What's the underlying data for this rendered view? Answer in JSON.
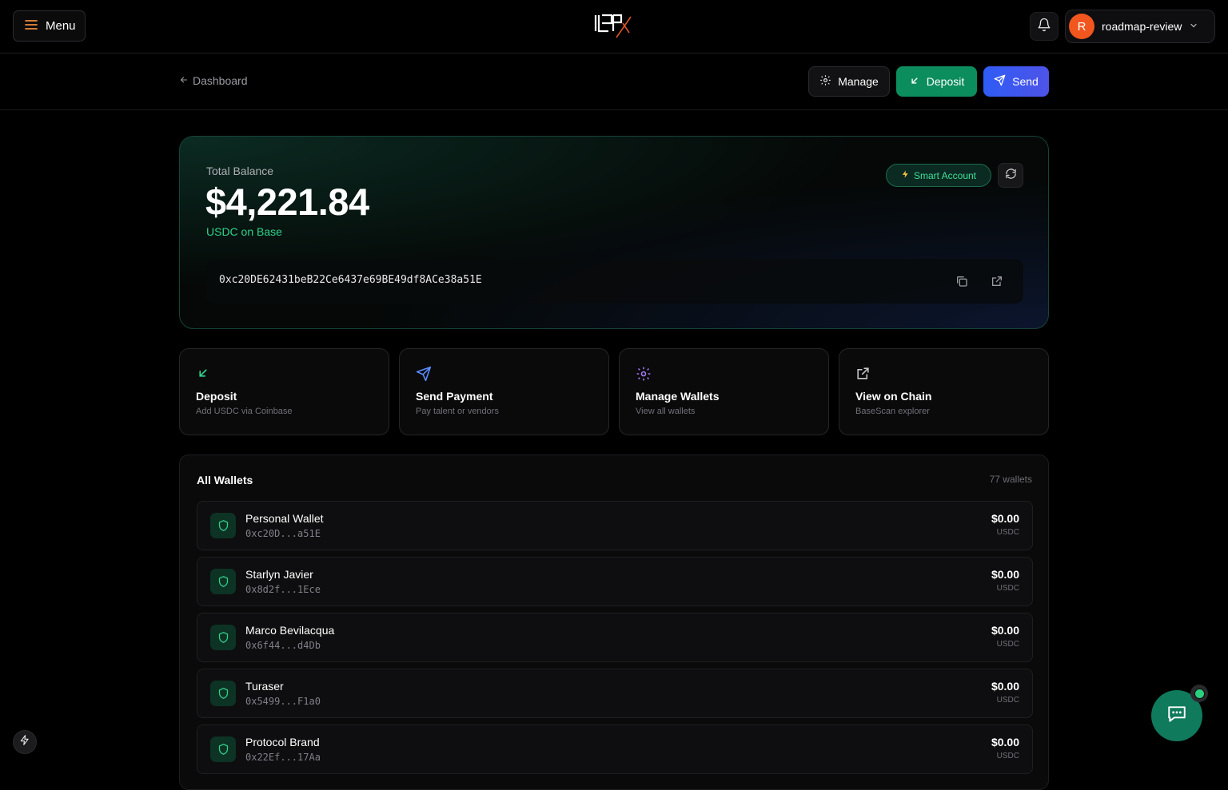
{
  "header": {
    "menu_label": "Menu",
    "user": {
      "initial": "R",
      "name": "roadmap-review"
    }
  },
  "subbar": {
    "back_label": "Dashboard",
    "manage_label": "Manage",
    "deposit_label": "Deposit",
    "send_label": "Send"
  },
  "balance": {
    "label": "Total Balance",
    "amount": "$4,221.84",
    "network": "USDC on Base",
    "badge": "Smart Account",
    "address": "0xc20DE62431beB22Ce6437e69BE49df8ACe38a51E"
  },
  "actions": [
    {
      "title": "Deposit",
      "subtitle": "Add USDC via Coinbase",
      "icon": "arrow-down-left-icon"
    },
    {
      "title": "Send Payment",
      "subtitle": "Pay talent or vendors",
      "icon": "send-icon"
    },
    {
      "title": "Manage Wallets",
      "subtitle": "View all wallets",
      "icon": "gear-icon"
    },
    {
      "title": "View on Chain",
      "subtitle": "BaseScan explorer",
      "icon": "external-link-icon"
    }
  ],
  "wallets": {
    "title": "All Wallets",
    "count": "77 wallets",
    "items": [
      {
        "name": "Personal Wallet",
        "address": "0xc20D...a51E",
        "amount": "$0.00",
        "currency": "USDC"
      },
      {
        "name": "Starlyn Javier",
        "address": "0x8d2f...1Ece",
        "amount": "$0.00",
        "currency": "USDC"
      },
      {
        "name": "Marco Bevilacqua",
        "address": "0x6f44...d4Db",
        "amount": "$0.00",
        "currency": "USDC"
      },
      {
        "name": "Turaser",
        "address": "0x5499...F1a0",
        "amount": "$0.00",
        "currency": "USDC"
      },
      {
        "name": "Protocol Brand",
        "address": "0x22Ef...17Aa",
        "amount": "$0.00",
        "currency": "USDC"
      }
    ]
  },
  "colors": {
    "accent_green": "#0c8d5e",
    "accent_blue": "#2f5cf5",
    "positive_text": "#2fd38a",
    "avatar": "#f0561d"
  }
}
